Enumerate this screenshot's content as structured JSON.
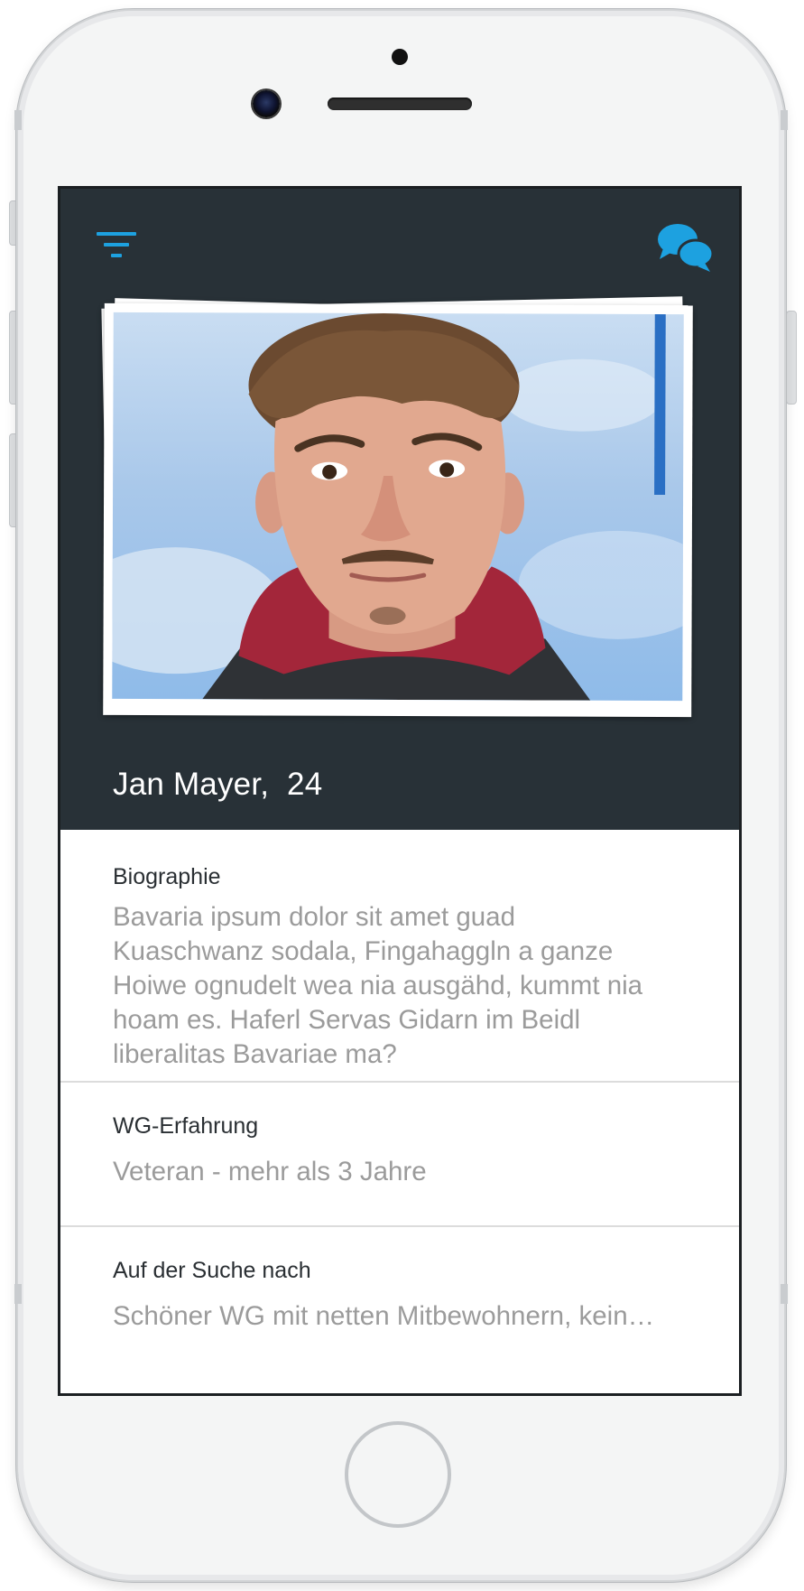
{
  "header": {
    "filter_icon": "filter-icon",
    "chat_icon": "chat-bubbles-icon",
    "accent_color": "#1da1e0"
  },
  "profile": {
    "name": "Jan Mayer,  24",
    "photo_alt": "profile-photo"
  },
  "sections": {
    "biography": {
      "title": "Biographie",
      "text": "Bavaria ipsum dolor sit amet guad Kuaschwanz sodala, Fingahaggln a ganze Hoiwe ognudelt wea nia ausgähd, kummt nia hoam es. Haferl Servas Gidarn im Beidl liberalitas Bavariae ma?"
    },
    "experience": {
      "title": "WG-Erfahrung",
      "text": "Veteran - mehr als 3 Jahre"
    },
    "looking_for": {
      "title": "Auf der Suche nach",
      "text": "Schöner WG mit netten Mitbewohnern, kein…"
    }
  },
  "colors": {
    "hero_background": "#283137",
    "text_primary": "#2a2f33",
    "text_secondary": "#9b9b9b"
  }
}
